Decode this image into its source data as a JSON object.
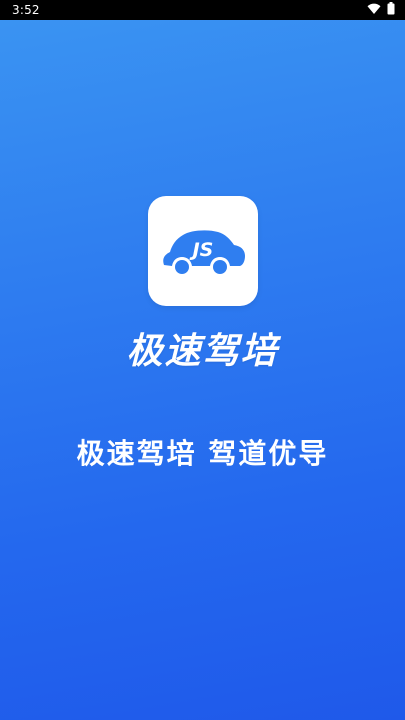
{
  "status_bar": {
    "time": "3:52",
    "icons": [
      "wifi-icon",
      "battery-icon"
    ]
  },
  "app_icon": {
    "logo_text": "JS",
    "icon_name": "car-icon",
    "brand_color": "#2f7ef0"
  },
  "app_name": "极速驾培",
  "slogan": "极速驾培  驾道优导",
  "background_colors": [
    "#3b95f2",
    "#1f59ea"
  ]
}
